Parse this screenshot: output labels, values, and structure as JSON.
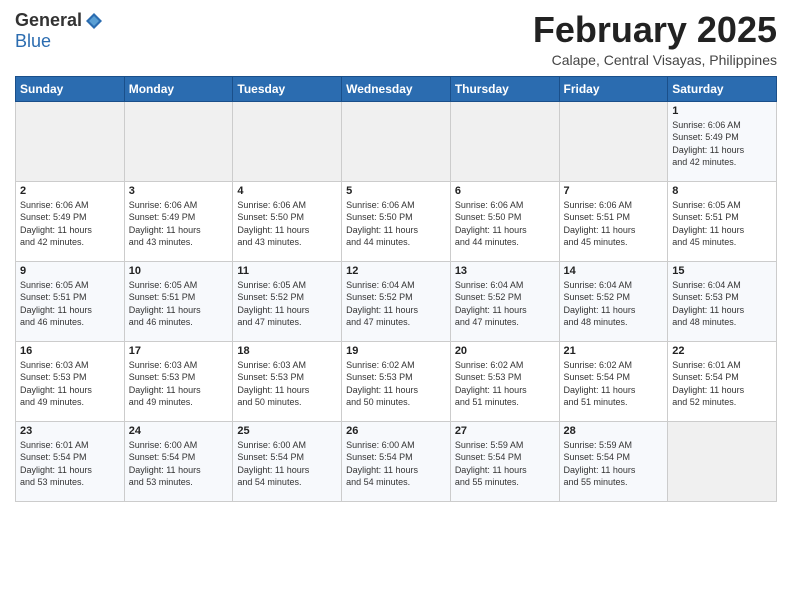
{
  "header": {
    "logo_general": "General",
    "logo_blue": "Blue",
    "month_title": "February 2025",
    "subtitle": "Calape, Central Visayas, Philippines"
  },
  "days_of_week": [
    "Sunday",
    "Monday",
    "Tuesday",
    "Wednesday",
    "Thursday",
    "Friday",
    "Saturday"
  ],
  "weeks": [
    [
      {
        "day": "",
        "info": ""
      },
      {
        "day": "",
        "info": ""
      },
      {
        "day": "",
        "info": ""
      },
      {
        "day": "",
        "info": ""
      },
      {
        "day": "",
        "info": ""
      },
      {
        "day": "",
        "info": ""
      },
      {
        "day": "1",
        "info": "Sunrise: 6:06 AM\nSunset: 5:49 PM\nDaylight: 11 hours\nand 42 minutes."
      }
    ],
    [
      {
        "day": "2",
        "info": "Sunrise: 6:06 AM\nSunset: 5:49 PM\nDaylight: 11 hours\nand 42 minutes."
      },
      {
        "day": "3",
        "info": "Sunrise: 6:06 AM\nSunset: 5:49 PM\nDaylight: 11 hours\nand 43 minutes."
      },
      {
        "day": "4",
        "info": "Sunrise: 6:06 AM\nSunset: 5:50 PM\nDaylight: 11 hours\nand 43 minutes."
      },
      {
        "day": "5",
        "info": "Sunrise: 6:06 AM\nSunset: 5:50 PM\nDaylight: 11 hours\nand 44 minutes."
      },
      {
        "day": "6",
        "info": "Sunrise: 6:06 AM\nSunset: 5:50 PM\nDaylight: 11 hours\nand 44 minutes."
      },
      {
        "day": "7",
        "info": "Sunrise: 6:06 AM\nSunset: 5:51 PM\nDaylight: 11 hours\nand 45 minutes."
      },
      {
        "day": "8",
        "info": "Sunrise: 6:05 AM\nSunset: 5:51 PM\nDaylight: 11 hours\nand 45 minutes."
      }
    ],
    [
      {
        "day": "9",
        "info": "Sunrise: 6:05 AM\nSunset: 5:51 PM\nDaylight: 11 hours\nand 46 minutes."
      },
      {
        "day": "10",
        "info": "Sunrise: 6:05 AM\nSunset: 5:51 PM\nDaylight: 11 hours\nand 46 minutes."
      },
      {
        "day": "11",
        "info": "Sunrise: 6:05 AM\nSunset: 5:52 PM\nDaylight: 11 hours\nand 47 minutes."
      },
      {
        "day": "12",
        "info": "Sunrise: 6:04 AM\nSunset: 5:52 PM\nDaylight: 11 hours\nand 47 minutes."
      },
      {
        "day": "13",
        "info": "Sunrise: 6:04 AM\nSunset: 5:52 PM\nDaylight: 11 hours\nand 47 minutes."
      },
      {
        "day": "14",
        "info": "Sunrise: 6:04 AM\nSunset: 5:52 PM\nDaylight: 11 hours\nand 48 minutes."
      },
      {
        "day": "15",
        "info": "Sunrise: 6:04 AM\nSunset: 5:53 PM\nDaylight: 11 hours\nand 48 minutes."
      }
    ],
    [
      {
        "day": "16",
        "info": "Sunrise: 6:03 AM\nSunset: 5:53 PM\nDaylight: 11 hours\nand 49 minutes."
      },
      {
        "day": "17",
        "info": "Sunrise: 6:03 AM\nSunset: 5:53 PM\nDaylight: 11 hours\nand 49 minutes."
      },
      {
        "day": "18",
        "info": "Sunrise: 6:03 AM\nSunset: 5:53 PM\nDaylight: 11 hours\nand 50 minutes."
      },
      {
        "day": "19",
        "info": "Sunrise: 6:02 AM\nSunset: 5:53 PM\nDaylight: 11 hours\nand 50 minutes."
      },
      {
        "day": "20",
        "info": "Sunrise: 6:02 AM\nSunset: 5:53 PM\nDaylight: 11 hours\nand 51 minutes."
      },
      {
        "day": "21",
        "info": "Sunrise: 6:02 AM\nSunset: 5:54 PM\nDaylight: 11 hours\nand 51 minutes."
      },
      {
        "day": "22",
        "info": "Sunrise: 6:01 AM\nSunset: 5:54 PM\nDaylight: 11 hours\nand 52 minutes."
      }
    ],
    [
      {
        "day": "23",
        "info": "Sunrise: 6:01 AM\nSunset: 5:54 PM\nDaylight: 11 hours\nand 53 minutes."
      },
      {
        "day": "24",
        "info": "Sunrise: 6:00 AM\nSunset: 5:54 PM\nDaylight: 11 hours\nand 53 minutes."
      },
      {
        "day": "25",
        "info": "Sunrise: 6:00 AM\nSunset: 5:54 PM\nDaylight: 11 hours\nand 54 minutes."
      },
      {
        "day": "26",
        "info": "Sunrise: 6:00 AM\nSunset: 5:54 PM\nDaylight: 11 hours\nand 54 minutes."
      },
      {
        "day": "27",
        "info": "Sunrise: 5:59 AM\nSunset: 5:54 PM\nDaylight: 11 hours\nand 55 minutes."
      },
      {
        "day": "28",
        "info": "Sunrise: 5:59 AM\nSunset: 5:54 PM\nDaylight: 11 hours\nand 55 minutes."
      },
      {
        "day": "",
        "info": ""
      }
    ]
  ]
}
